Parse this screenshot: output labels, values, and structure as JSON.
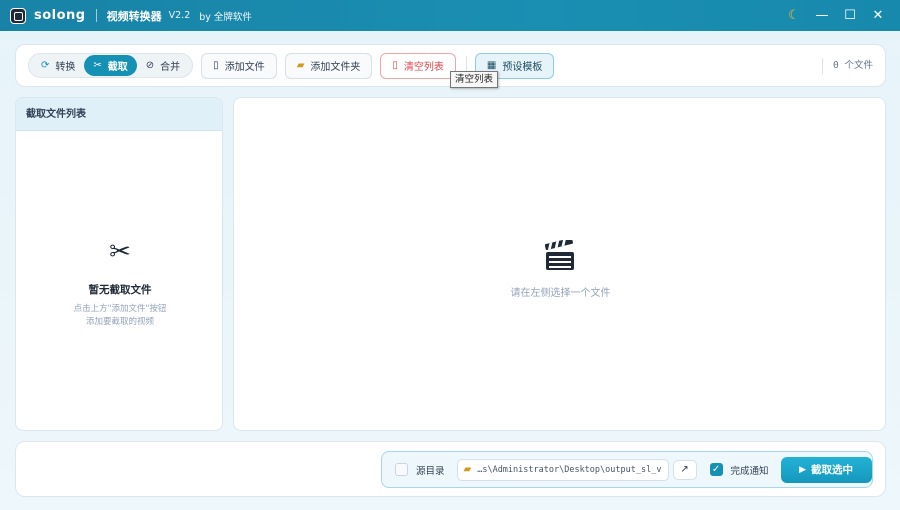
{
  "titlebar": {
    "app_name": "solong",
    "title": "视频转换器",
    "version": "V2.2",
    "by": "by 全牌软件",
    "theme_icon": "moon-icon",
    "minimize": "—",
    "maximize": "☐",
    "close": "✕"
  },
  "toolbar": {
    "modes": [
      {
        "label": "转换",
        "icon": "convert-icon",
        "active": false
      },
      {
        "label": "截取",
        "icon": "scissors-icon",
        "active": true
      },
      {
        "label": "合并",
        "icon": "merge-icon",
        "active": false
      }
    ],
    "add_file": "添加文件",
    "add_folder": "添加文件夹",
    "clear_list": "清空列表",
    "preset": "预设模板",
    "file_count": "0 个文件",
    "tooltip": "清空列表"
  },
  "left_panel": {
    "header": "截取文件列表",
    "empty_title": "暂无截取文件",
    "empty_hint_line1": "点击上方\"添加文件\"按钮",
    "empty_hint_line2": "添加要截取的视频"
  },
  "main_panel": {
    "hint": "请在左侧选择一个文件"
  },
  "bottom": {
    "source_dir_label": "源目录",
    "source_dir_checked": false,
    "output_path": "…s\\Administrator\\Desktop\\output_sl_vc",
    "open_icon": "↗",
    "notify_label": "完成通知",
    "notify_checked": true,
    "run_label": "截取选中"
  },
  "colors": {
    "accent": "#1591b3",
    "titlebar": "#1883a6",
    "danger": "#e0474c"
  }
}
